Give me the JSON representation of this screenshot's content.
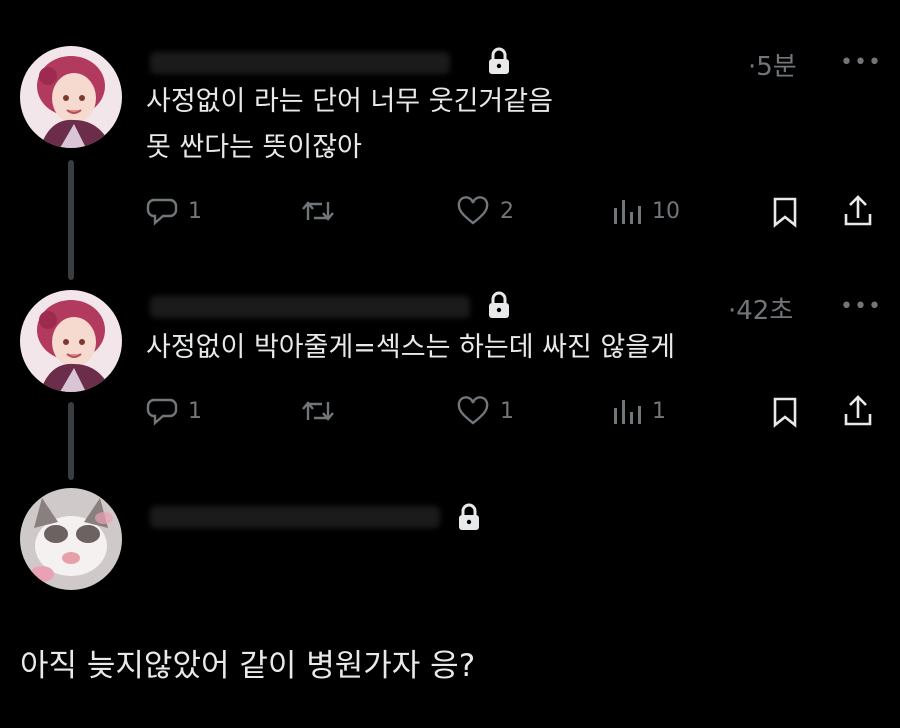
{
  "posts": [
    {
      "time": "·5분",
      "more": "•••",
      "lines": [
        "사정없이 라는 단어 너무 웃긴거같음",
        "못 싼다는 뜻이잖아"
      ],
      "actions": {
        "replies": "1",
        "reposts": "",
        "likes": "2",
        "views": "10"
      }
    },
    {
      "time": "·42초",
      "more": "•••",
      "lines": [
        "사정없이 박아줄게=섹스는 하는데 싸진 않을게"
      ],
      "actions": {
        "replies": "1",
        "reposts": "",
        "likes": "1",
        "views": "1"
      }
    }
  ],
  "reply": {
    "text": "아직 늦지않았어 같이 병원가자 응?"
  },
  "icons": {
    "lock": "lock-icon",
    "reply": "reply-icon",
    "repost": "repost-icon",
    "like": "heart-icon",
    "views": "views-icon",
    "bookmark": "bookmark-icon",
    "share": "share-icon"
  },
  "colors": {
    "background": "#000000",
    "text": "#e7e9ea",
    "muted": "#71767b",
    "thread_line": "#3a3d40"
  }
}
